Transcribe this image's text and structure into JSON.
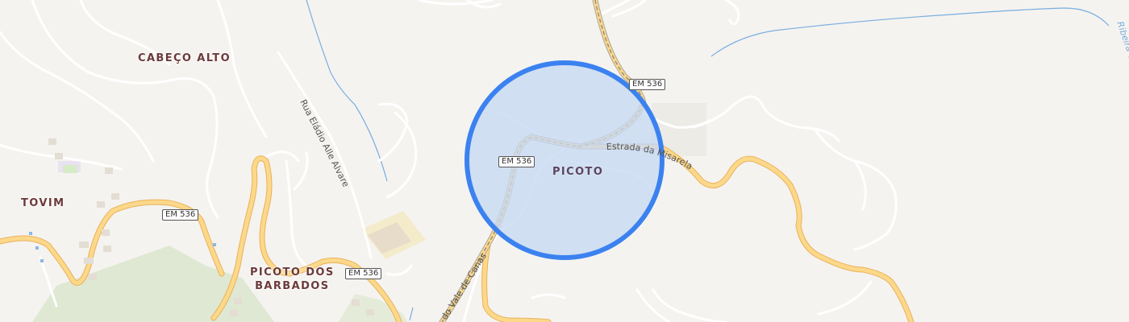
{
  "map": {
    "places": {
      "cabeco_alto": "CABEÇO ALTO",
      "tovim": "TOVIM",
      "picoto_dos_barbados_line1": "PICOTO DOS",
      "picoto_dos_barbados_line2": "BARBADOS",
      "picoto": "PICOTO"
    },
    "roads": {
      "em536": "EM 536",
      "rua_eladio": "Rua Eládio Alle Alvarez",
      "estrada_misarela": "Estrada da Misarela",
      "vale_de_canas": "do Vale de Canas"
    },
    "waterways": {
      "ribeira": "Ribeira-de-M"
    },
    "colors": {
      "land": "#f5f3f0",
      "minor_road": "#ffffff",
      "main_road_fill": "#fcd88a",
      "main_road_casing": "#e8b25a",
      "water": "#79aee0",
      "wood": "#dfe8d2",
      "selection_fill": "#c6d8f4",
      "selection_stroke": "#3b82f0",
      "place_label": "#6b3a3a"
    }
  }
}
